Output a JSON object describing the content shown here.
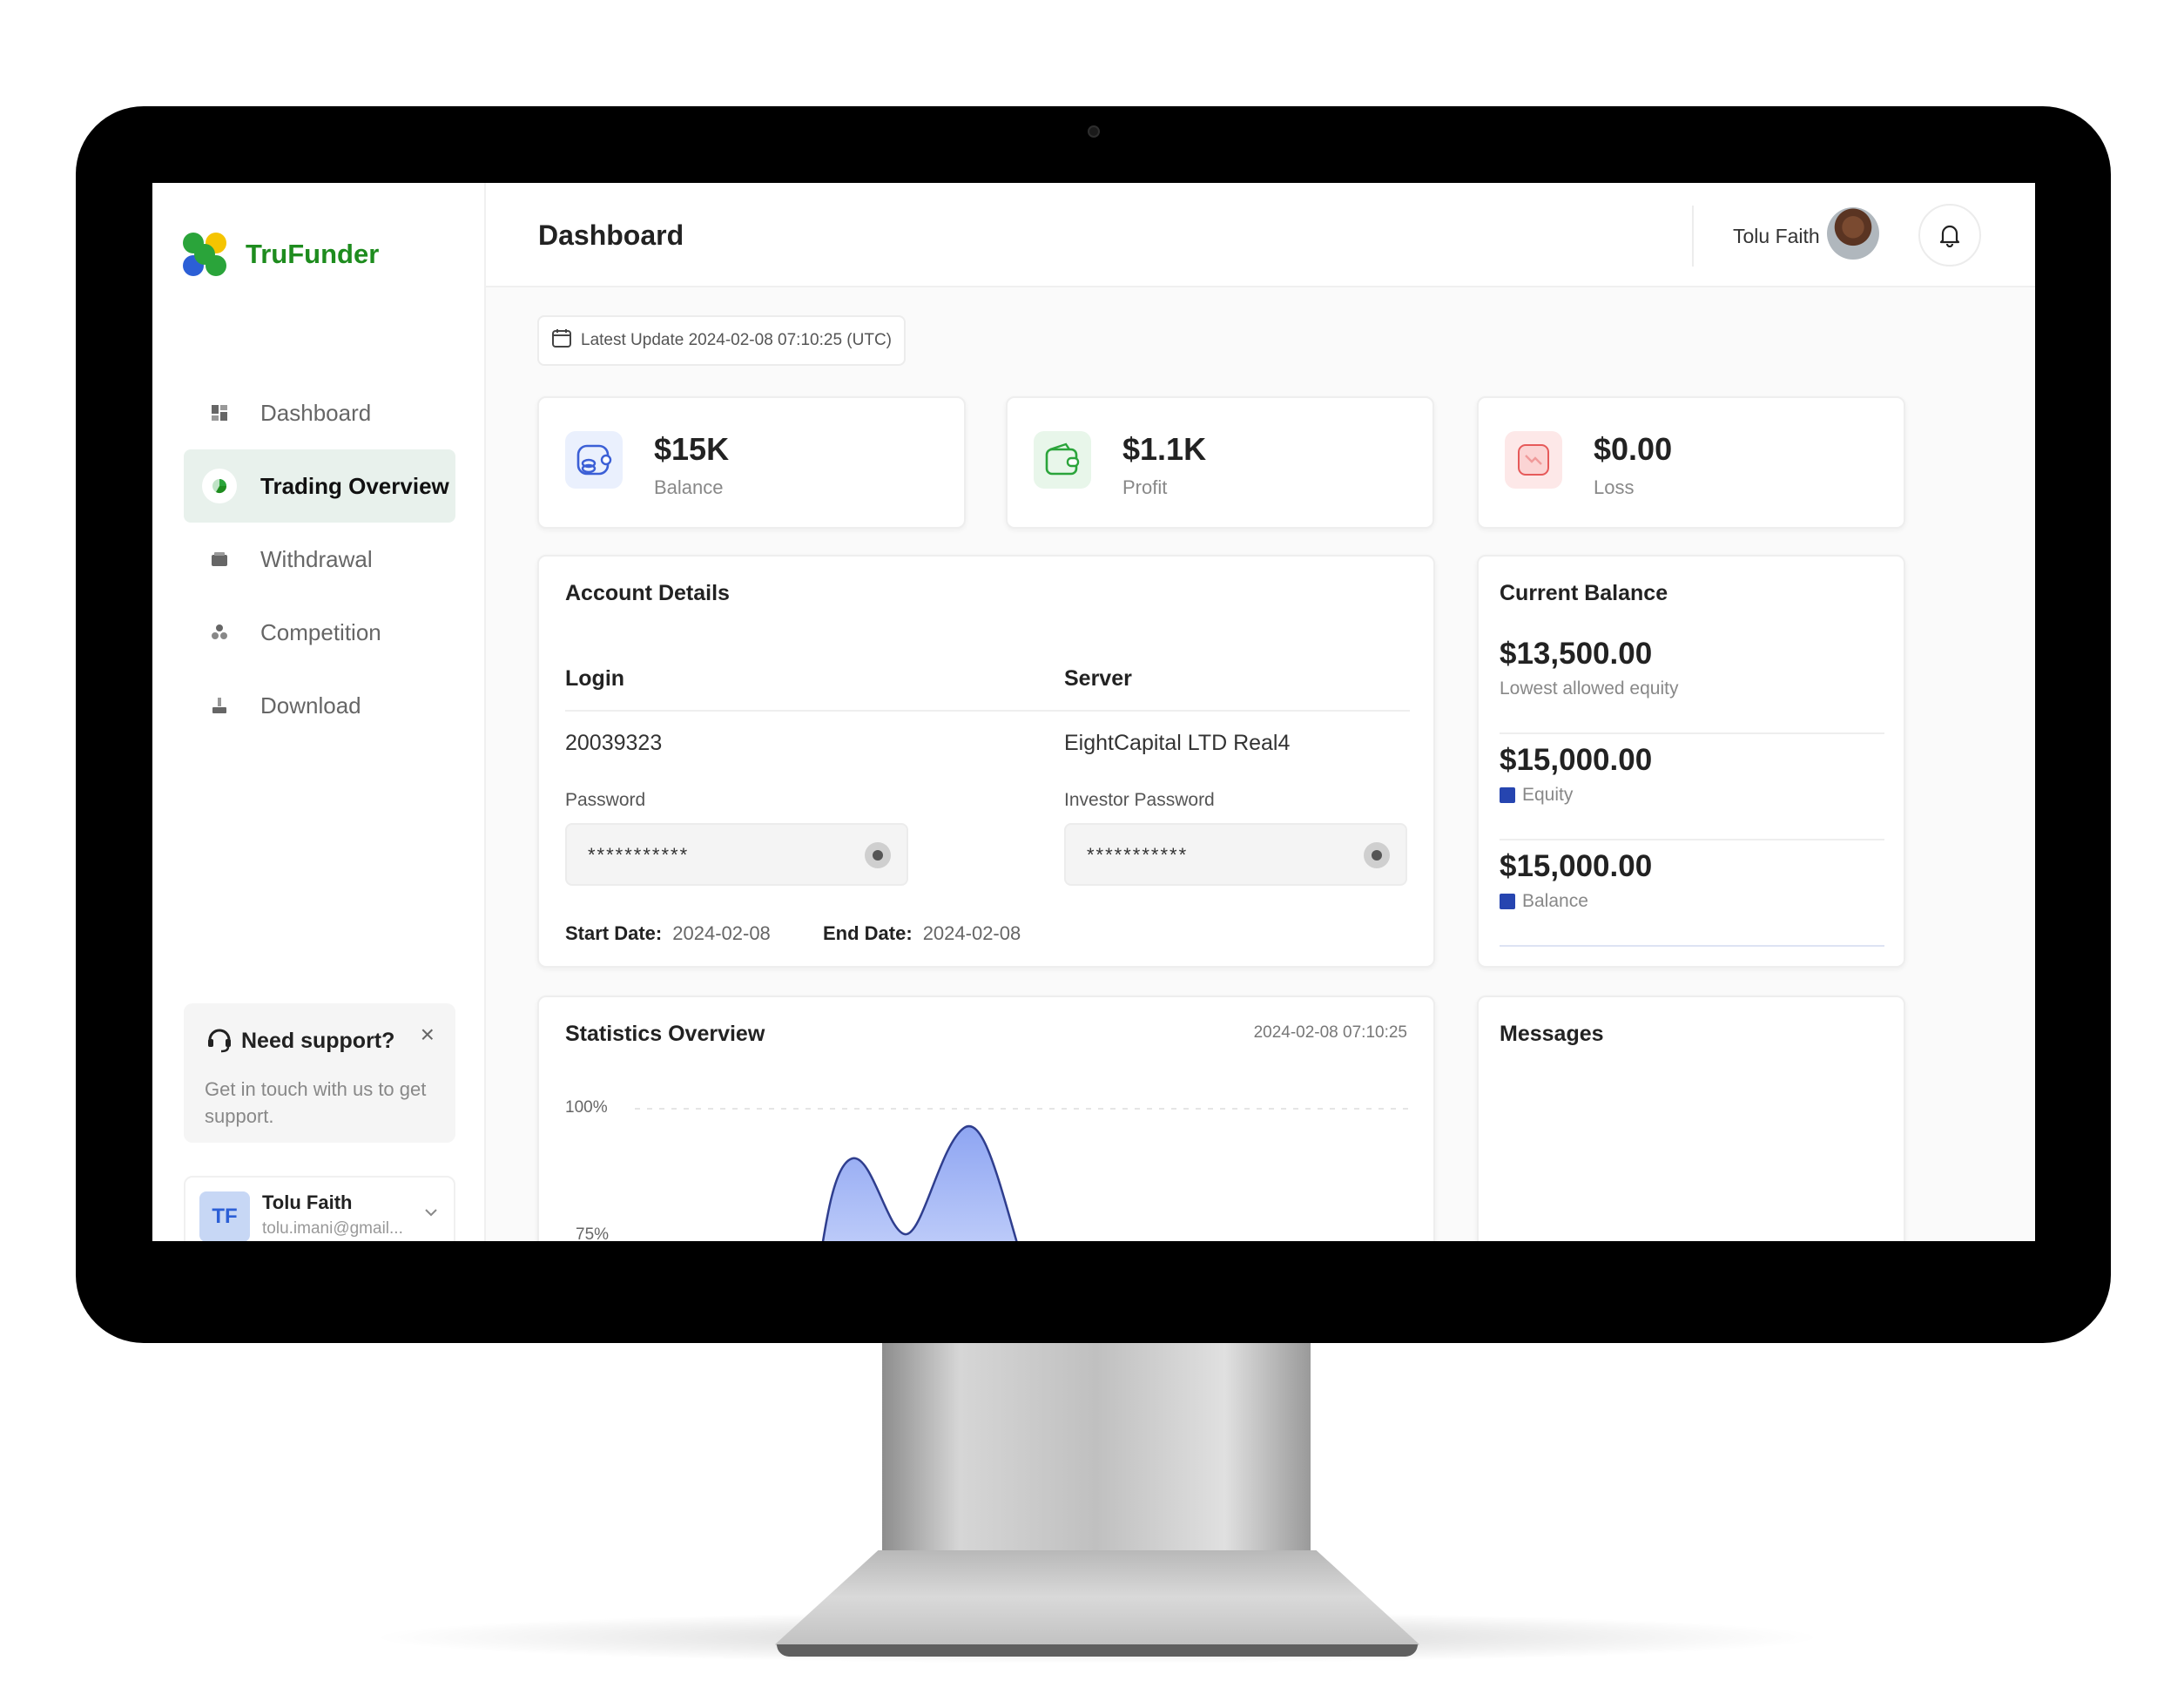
{
  "app": {
    "name": "TruFunder"
  },
  "sidebar": {
    "items": [
      {
        "label": "Dashboard",
        "icon": "dashboard-icon"
      },
      {
        "label": "Trading Overview",
        "icon": "pie-chart-icon",
        "active": true
      },
      {
        "label": "Withdrawal",
        "icon": "wallet-icon"
      },
      {
        "label": "Competition",
        "icon": "trophy-icon"
      },
      {
        "label": "Download",
        "icon": "download-icon"
      }
    ],
    "support": {
      "title": "Need support?",
      "text": "Get in touch with us to get support.",
      "close": "×"
    },
    "user": {
      "initials": "TF",
      "name": "Tolu Faith",
      "email": "tolu.imani@gmail..."
    }
  },
  "header": {
    "title": "Dashboard",
    "user_name": "Tolu Faith"
  },
  "main": {
    "latest_update": "Latest Update 2024-02-08 07:10:25 (UTC)",
    "stats": [
      {
        "value": "$15K",
        "label": "Balance",
        "icon": "coins-icon",
        "color": "#3b5fd6"
      },
      {
        "value": "$1.1K",
        "label": "Profit",
        "icon": "wallet-icon",
        "color": "#2aa43a"
      },
      {
        "value": "$0.00",
        "label": "Loss",
        "icon": "trend-down-icon",
        "color": "#e65a5a"
      }
    ],
    "account": {
      "title": "Account Details",
      "login_header": "Login",
      "server_header": "Server",
      "login_value": "20039323",
      "server_value": "EightCapital LTD Real4",
      "password_label": "Password",
      "investor_password_label": "Investor Password",
      "password_mask": "***********",
      "investor_password_mask": "***********",
      "start_date_label": "Start Date:",
      "start_date": "2024-02-08",
      "end_date_label": "End Date:",
      "end_date": "2024-02-08"
    },
    "balance": {
      "title": "Current Balance",
      "rows": [
        {
          "amount": "$13,500.00",
          "label": "Lowest allowed equity"
        },
        {
          "amount": "$15,000.00",
          "label": "Equity"
        },
        {
          "amount": "$15,000.00",
          "label": "Balance"
        }
      ]
    },
    "statistics": {
      "title": "Statistics Overview",
      "date": "2024-02-08 07:10:25"
    },
    "messages": {
      "title": "Messages"
    }
  },
  "chart_data": {
    "type": "area",
    "title": "Statistics Overview",
    "y_tick_labels": [
      "100%",
      "75%"
    ],
    "series_color": "#3b5fd6",
    "grid": true
  },
  "colors": {
    "brand_green": "#1e8c1e",
    "accent_blue": "#2645b0",
    "active_bg": "#e8f1ec"
  }
}
